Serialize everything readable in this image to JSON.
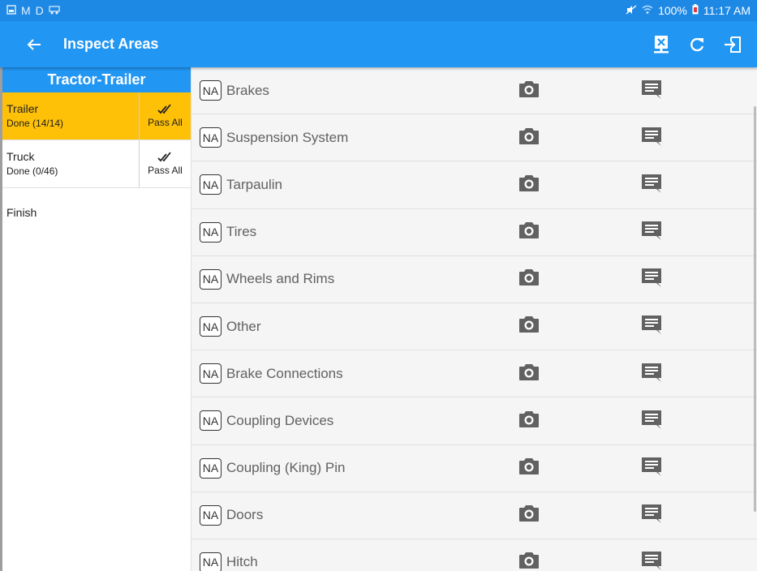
{
  "status_bar": {
    "left_icons": [
      "M",
      "D"
    ],
    "battery": "100%",
    "time": "11:17 AM"
  },
  "app_bar": {
    "title": "Inspect Areas",
    "actions": [
      "delete-report-icon",
      "refresh-icon",
      "exit-icon"
    ]
  },
  "left_panel": {
    "header": "Tractor-Trailer",
    "areas": [
      {
        "name": "Trailer",
        "status": "Done (14/14)",
        "pass_label": "Pass All",
        "selected": true
      },
      {
        "name": "Truck",
        "status": "Done (0/46)",
        "pass_label": "Pass All",
        "selected": false
      }
    ],
    "finish_label": "Finish"
  },
  "inspection_items": {
    "na_label": "NA",
    "items": [
      "Brakes",
      "Suspension System",
      "Tarpaulin",
      "Tires",
      "Wheels and Rims",
      "Other",
      "Brake Connections",
      "Coupling Devices",
      "Coupling (King) Pin",
      "Doors",
      "Hitch"
    ]
  },
  "colors": {
    "primary": "#2196f3",
    "status_bar": "#1e88e5",
    "selected": "#ffc107",
    "icon_gray": "#616161"
  }
}
